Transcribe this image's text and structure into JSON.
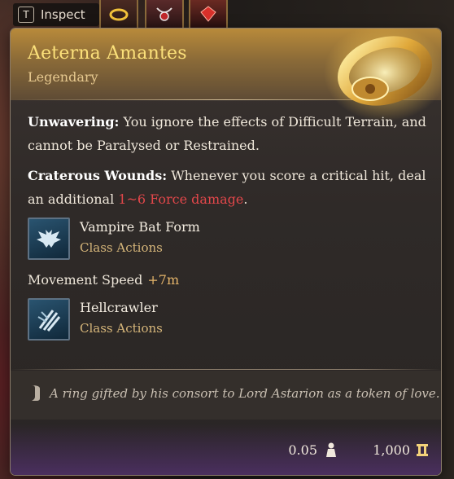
{
  "topbar": {
    "inspect_key": "T",
    "inspect_label": "Inspect"
  },
  "item": {
    "name": "Aeterna Amantes",
    "rarity": "Legendary",
    "effects": [
      {
        "name": "Unwavering:",
        "text": " You ignore the effects of Difficult Terrain, and cannot be Paralysed or Restrained."
      },
      {
        "name": "Craterous Wounds:",
        "text_before": " Whenever you score a critical hit, deal an additional ",
        "damage": "1~6 Force damage",
        "text_after": "."
      }
    ],
    "actions": [
      {
        "name": "Vampire Bat Form",
        "type": "Class Actions",
        "icon": "bat-icon"
      },
      {
        "name": "Hellcrawler",
        "type": "Class Actions",
        "icon": "claw-icon"
      }
    ],
    "movement": {
      "label": "Movement Speed",
      "value": "+7m"
    },
    "flavor": "A ring gifted by his consort to Lord Astarion as a token of love.",
    "weight": "0.05",
    "price": "1,000"
  },
  "colors": {
    "title": "#fbe07a",
    "rarity": "#e7c98f",
    "damage": "#e2474a",
    "action_type": "#d6b67a",
    "movement_value": "#e4b46a"
  }
}
